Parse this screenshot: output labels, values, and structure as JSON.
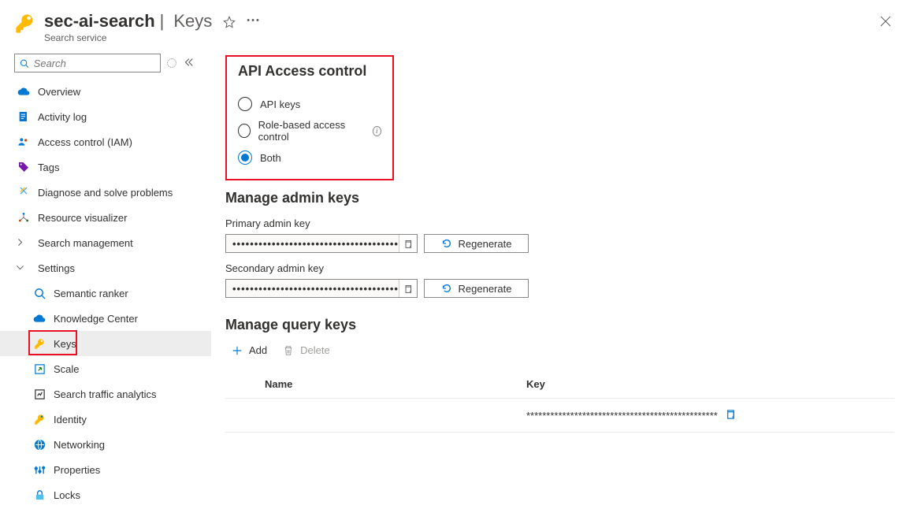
{
  "header": {
    "resource_name": "sec-ai-search",
    "page_name": "Keys",
    "subtitle": "Search service"
  },
  "sidebar": {
    "search_placeholder": "Search",
    "items": {
      "overview": "Overview",
      "activity_log": "Activity log",
      "access_control": "Access control (IAM)",
      "tags": "Tags",
      "diagnose": "Diagnose and solve problems",
      "resource_visualizer": "Resource visualizer",
      "search_management": "Search management",
      "settings": "Settings",
      "semantic_ranker": "Semantic ranker",
      "knowledge_center": "Knowledge Center",
      "keys": "Keys",
      "scale": "Scale",
      "traffic_analytics": "Search traffic analytics",
      "identity": "Identity",
      "networking": "Networking",
      "properties": "Properties",
      "locks": "Locks"
    }
  },
  "content": {
    "api_access_title": "API Access control",
    "radio_api_keys": "API keys",
    "radio_rbac": "Role-based access control",
    "radio_both": "Both",
    "api_selected": "both",
    "manage_admin_title": "Manage admin keys",
    "primary_label": "Primary admin key",
    "secondary_label": "Secondary admin key",
    "masked_value": "••••••••••••••••••••••••••••••••••••••••",
    "regenerate_label": "Regenerate",
    "manage_query_title": "Manage query keys",
    "add_label": "Add",
    "delete_label": "Delete",
    "col_name": "Name",
    "col_key": "Key",
    "row1_name": "",
    "row1_key": "************************************************"
  }
}
